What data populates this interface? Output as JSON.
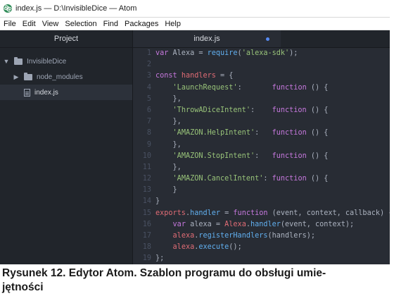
{
  "window": {
    "title": "index.js — D:\\InvisibleDice — Atom",
    "icon": "atom-app-icon"
  },
  "menu": [
    "File",
    "Edit",
    "View",
    "Selection",
    "Find",
    "Packages",
    "Help"
  ],
  "sidebar": {
    "header": "Project",
    "items": [
      {
        "label": "InvisibleDice",
        "type": "folder",
        "expanded": true
      },
      {
        "label": "node_modules",
        "type": "folder",
        "expanded": false
      },
      {
        "label": "index.js",
        "type": "file",
        "selected": true
      }
    ]
  },
  "editor": {
    "tab_label": "index.js",
    "tab_modified": true,
    "lines": [
      {
        "n": "1",
        "tokens": [
          [
            "keyword",
            "var"
          ],
          [
            "plain",
            " Alexa = "
          ],
          [
            "func",
            "require"
          ],
          [
            "plain",
            "("
          ],
          [
            "string",
            "'alexa-sdk'"
          ],
          [
            "plain",
            ");"
          ]
        ]
      },
      {
        "n": "2",
        "tokens": []
      },
      {
        "n": "3",
        "tokens": [
          [
            "keyword",
            "const"
          ],
          [
            "plain",
            " "
          ],
          [
            "var",
            "handlers"
          ],
          [
            "plain",
            " = {"
          ]
        ]
      },
      {
        "n": "4",
        "tokens": [
          [
            "plain",
            "    "
          ],
          [
            "string",
            "'LaunchRequest'"
          ],
          [
            "plain",
            ":       "
          ],
          [
            "keyword",
            "function"
          ],
          [
            "plain",
            " () {"
          ]
        ]
      },
      {
        "n": "5",
        "tokens": [
          [
            "plain",
            "    },"
          ]
        ]
      },
      {
        "n": "6",
        "tokens": [
          [
            "plain",
            "    "
          ],
          [
            "string",
            "'ThrowADiceIntent'"
          ],
          [
            "plain",
            ":    "
          ],
          [
            "keyword",
            "function"
          ],
          [
            "plain",
            " () {"
          ]
        ]
      },
      {
        "n": "7",
        "tokens": [
          [
            "plain",
            "    },"
          ]
        ]
      },
      {
        "n": "8",
        "tokens": [
          [
            "plain",
            "    "
          ],
          [
            "string",
            "'AMAZON.HelpIntent'"
          ],
          [
            "plain",
            ":   "
          ],
          [
            "keyword",
            "function"
          ],
          [
            "plain",
            " () {"
          ]
        ]
      },
      {
        "n": "9",
        "tokens": [
          [
            "plain",
            "    },"
          ]
        ]
      },
      {
        "n": "10",
        "tokens": [
          [
            "plain",
            "    "
          ],
          [
            "string",
            "'AMAZON.StopIntent'"
          ],
          [
            "plain",
            ":   "
          ],
          [
            "keyword",
            "function"
          ],
          [
            "plain",
            " () {"
          ]
        ]
      },
      {
        "n": "11",
        "tokens": [
          [
            "plain",
            "    },"
          ]
        ]
      },
      {
        "n": "12",
        "tokens": [
          [
            "plain",
            "    "
          ],
          [
            "string",
            "'AMAZON.CancelIntent'"
          ],
          [
            "plain",
            ": "
          ],
          [
            "keyword",
            "function"
          ],
          [
            "plain",
            " () {"
          ]
        ]
      },
      {
        "n": "13",
        "tokens": [
          [
            "plain",
            "    }"
          ]
        ]
      },
      {
        "n": "14",
        "tokens": [
          [
            "plain",
            "}"
          ]
        ]
      },
      {
        "n": "15",
        "tokens": [
          [
            "var",
            "exports"
          ],
          [
            "plain",
            "."
          ],
          [
            "func",
            "handler"
          ],
          [
            "plain",
            " = "
          ],
          [
            "keyword",
            "function"
          ],
          [
            "plain",
            " (event, context, callback) {"
          ]
        ]
      },
      {
        "n": "16",
        "tokens": [
          [
            "plain",
            "    "
          ],
          [
            "keyword",
            "var"
          ],
          [
            "plain",
            " alexa = "
          ],
          [
            "var",
            "Alexa"
          ],
          [
            "plain",
            "."
          ],
          [
            "func",
            "handler"
          ],
          [
            "plain",
            "(event, context);"
          ]
        ]
      },
      {
        "n": "17",
        "tokens": [
          [
            "plain",
            "    "
          ],
          [
            "var",
            "alexa"
          ],
          [
            "plain",
            "."
          ],
          [
            "func",
            "registerHandlers"
          ],
          [
            "plain",
            "(handlers);"
          ]
        ]
      },
      {
        "n": "18",
        "tokens": [
          [
            "plain",
            "    "
          ],
          [
            "var",
            "alexa"
          ],
          [
            "plain",
            "."
          ],
          [
            "func",
            "execute"
          ],
          [
            "plain",
            "();"
          ]
        ]
      },
      {
        "n": "19",
        "tokens": [
          [
            "plain",
            "};"
          ]
        ]
      }
    ]
  },
  "caption": "Rysunek 12. Edytor Atom. Szablon programu do obsługi umie-\njętności",
  "colors": {
    "editor_bg": "#282c34",
    "sidebar_bg": "#21252b",
    "keyword": "#c678dd",
    "string": "#98c379",
    "function": "#61afef",
    "variable": "#e06c75",
    "modified_dot": "#568af2"
  }
}
